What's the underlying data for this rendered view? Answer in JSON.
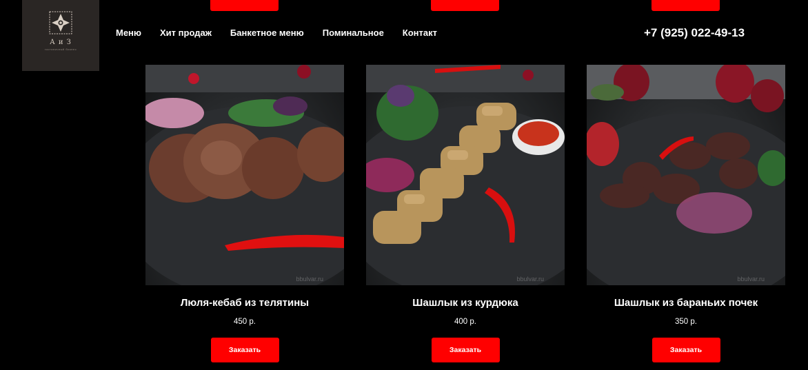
{
  "header": {
    "logo": {
      "text": "А и З",
      "subtitle": "гостиничный бизнес"
    },
    "nav": [
      "Меню",
      "Хит продаж",
      "Банкетное меню",
      "Поминальное",
      "Контакт"
    ],
    "phone": "+7 (925) 022-49-13"
  },
  "products": [
    {
      "title": "Люля-кебаб из телятины",
      "price": "450 р.",
      "button": "Заказать",
      "watermark": "bbulvar.ru",
      "image": "lyulya-kebab-photo"
    },
    {
      "title": "Шашлык из курдюка",
      "price": "400 р.",
      "button": "Заказать",
      "watermark": "bbulvar.ru",
      "image": "kurdyuk-shashlik-photo"
    },
    {
      "title": "Шашлык из бараньих почек",
      "price": "350 р.",
      "button": "Заказать",
      "watermark": "bbulvar.ru",
      "image": "kidney-shashlik-photo"
    }
  ],
  "colors": {
    "background": "#000000",
    "accent": "#ff0000",
    "logo_bg": "#2a2624"
  }
}
